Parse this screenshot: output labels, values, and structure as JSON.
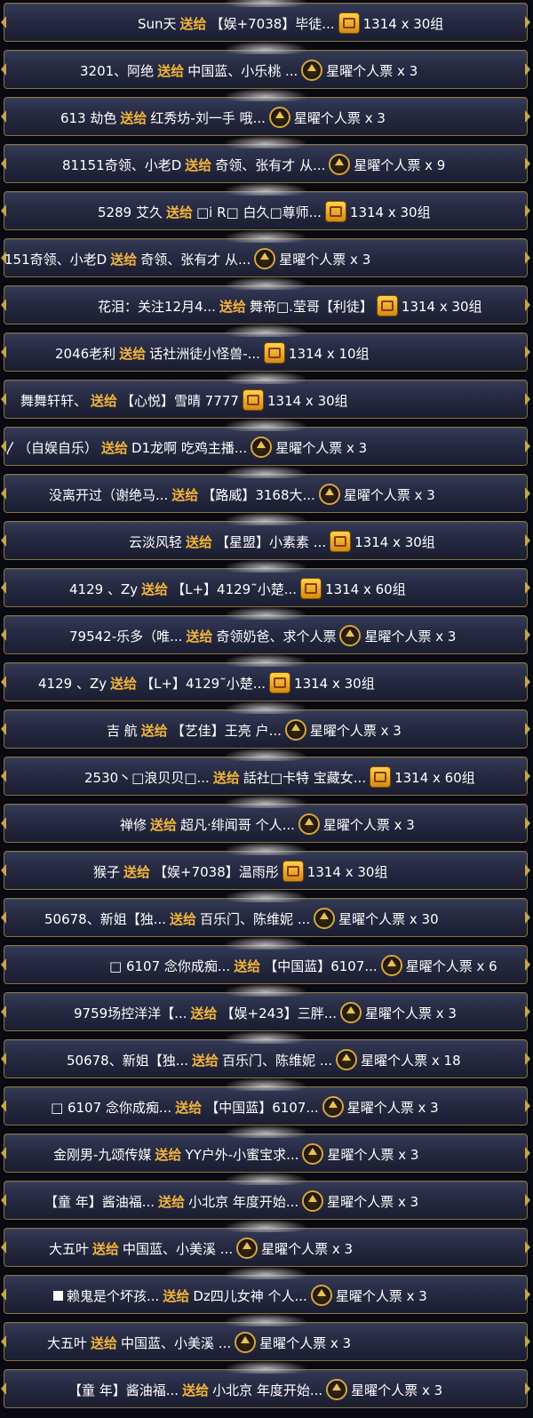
{
  "feed": {
    "rows": [
      {
        "sender": "Sun天",
        "verb": "送给",
        "receiver": "【娱+7038】毕徒...",
        "icon": "gift-box-icon",
        "gift": "1314 x 30组"
      },
      {
        "sender": "3201、阿绝",
        "verb": "送给",
        "receiver": "中国蓝、小乐桃 ...",
        "icon": "ticket-badge-icon",
        "gift": "星曜个人票 x 3"
      },
      {
        "sender": "613 劫色",
        "verb": "送给",
        "receiver": "红秀坊-刘一手 哦...",
        "icon": "ticket-badge-icon",
        "gift": "星曜个人票 x 3"
      },
      {
        "sender": "81151奇领、小老D",
        "verb": "送给",
        "receiver": "奇领、张有才 从...",
        "icon": "ticket-badge-icon",
        "gift": "星曜个人票 x 9"
      },
      {
        "sender": "5289 艾久",
        "verb": "送给",
        "receiver": "□i R□ 白久□尊师...",
        "icon": "gift-box-icon",
        "gift": "1314 x 30组"
      },
      {
        "sender": "151奇领、小老D",
        "verb": "送给",
        "receiver": "奇领、张有才 从...",
        "icon": "ticket-badge-icon",
        "gift": "星曜个人票 x 3"
      },
      {
        "sender": "花泪：关注12月4...",
        "verb": "送给",
        "receiver": "舞帝□.莹哥【利徒】",
        "icon": "gift-box-icon",
        "gift": "1314 x 30组"
      },
      {
        "sender": "2046老利",
        "verb": "送给",
        "receiver": "话社洲徒小怪兽-...",
        "icon": "gift-box-icon",
        "gift": "1314 x 10组"
      },
      {
        "sender": "舞舞轩轩、",
        "verb": "送给",
        "receiver": "【心悦】雪晴 7777",
        "icon": "gift-box-icon",
        "gift": "1314 x 30组"
      },
      {
        "sender": "〳（自娱自乐）",
        "verb": "送给",
        "receiver": "D1龙啊 吃鸡主播...",
        "icon": "ticket-badge-icon",
        "gift": "星曜个人票 x 3"
      },
      {
        "sender": "没离开过（谢绝马...",
        "verb": "送给",
        "receiver": "【路威】3168大...",
        "icon": "ticket-badge-icon",
        "gift": "星曜个人票 x 3"
      },
      {
        "sender": "云淡风轻",
        "verb": "送给",
        "receiver": "【星盟】小素素 ...",
        "icon": "gift-box-icon",
        "gift": "1314 x 30组"
      },
      {
        "sender": "4129 、Zy",
        "verb": "送给",
        "receiver": "【L+】4129˜小楚...",
        "icon": "gift-box-icon",
        "gift": "1314 x 60组"
      },
      {
        "sender": "79542-乐多（唯...",
        "verb": "送给",
        "receiver": "奇领奶爸、求个人票",
        "icon": "ticket-badge-icon",
        "gift": "星曜个人票 x 3"
      },
      {
        "sender": "4129 、Zy",
        "verb": "送给",
        "receiver": "【L+】4129˜小楚...",
        "icon": "gift-box-icon",
        "gift": "1314 x 30组"
      },
      {
        "sender": "吉 航",
        "verb": "送给",
        "receiver": "【艺佳】王亮 户...",
        "icon": "ticket-badge-icon",
        "gift": "星曜个人票 x 3"
      },
      {
        "sender": "2530丶□浪贝贝□...",
        "verb": "送给",
        "receiver": "話社□卡特 宝藏女...",
        "icon": "gift-box-icon",
        "gift": "1314 x 60组"
      },
      {
        "sender": "禅修",
        "verb": "送给",
        "receiver": "超凡·绯闻哥 个人...",
        "icon": "ticket-badge-icon",
        "gift": "星曜个人票 x 3"
      },
      {
        "sender": "猴子",
        "verb": "送给",
        "receiver": "【娱+7038】温雨彤",
        "icon": "gift-box-icon",
        "gift": "1314 x 30组"
      },
      {
        "sender": "50678、新姐【独...",
        "verb": "送给",
        "receiver": "百乐门、陈维妮 ...",
        "icon": "ticket-badge-icon",
        "gift": "星曜个人票 x 30"
      },
      {
        "sender": "□ 6107 念你成痴...",
        "verb": "送给",
        "receiver": "【中国蓝】6107...",
        "icon": "ticket-badge-icon",
        "gift": "星曜个人票 x 6"
      },
      {
        "sender": "9759场控洋洋【...",
        "verb": "送给",
        "receiver": "【娱+243】三胖...",
        "icon": "ticket-badge-icon",
        "gift": "星曜个人票 x 3"
      },
      {
        "sender": "50678、新姐【独...",
        "verb": "送给",
        "receiver": "百乐门、陈维妮 ...",
        "icon": "ticket-badge-icon",
        "gift": "星曜个人票 x 18"
      },
      {
        "sender": "□ 6107 念你成痴...",
        "verb": "送给",
        "receiver": "【中国蓝】6107...",
        "icon": "ticket-badge-icon",
        "gift": "星曜个人票 x 3"
      },
      {
        "sender": "金刚男-九颂传媒",
        "verb": "送给",
        "receiver": "YY户外-小蜜宝求...",
        "icon": "ticket-badge-icon",
        "gift": "星曜个人票 x 3"
      },
      {
        "sender": "【童 年】酱油福...",
        "verb": "送给",
        "receiver": "小北京 年度开始...",
        "icon": "ticket-badge-icon",
        "gift": "星曜个人票 x 3"
      },
      {
        "sender": "大五叶",
        "verb": "送给",
        "receiver": "中国蓝、小美溪 ...",
        "icon": "ticket-badge-icon",
        "gift": "星曜个人票 x 3"
      },
      {
        "sender": "赖鬼是个坏孩...",
        "verb": "送给",
        "receiver": "Dz四儿女神 个人...",
        "icon": "ticket-badge-icon",
        "gift": "星曜个人票 x 3",
        "has_square": true
      },
      {
        "sender": "大五叶",
        "verb": "送给",
        "receiver": "中国蓝、小美溪 ...",
        "icon": "ticket-badge-icon",
        "gift": "星曜个人票 x 3"
      },
      {
        "sender": "【童 年】酱油福...",
        "verb": "送给",
        "receiver": "小北京 年度开始...",
        "icon": "ticket-badge-icon",
        "gift": "星曜个人票 x 3"
      }
    ]
  },
  "colors": {
    "verb": "#f2b43a",
    "text": "#ffffff",
    "row_border": "#8a7440",
    "row_bg": "#262a42"
  }
}
